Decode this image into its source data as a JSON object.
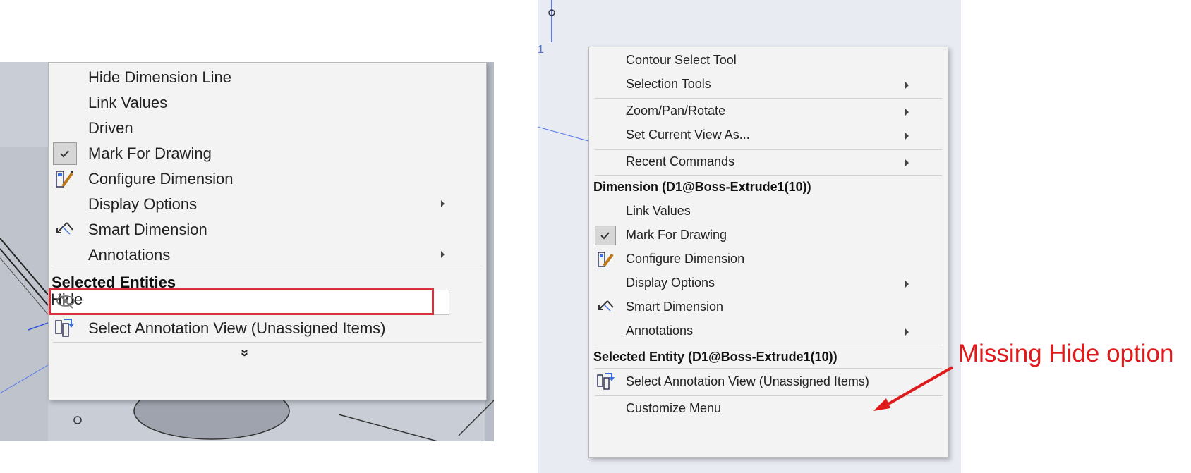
{
  "left_menu": {
    "items": [
      {
        "label": "Hide Dimension Line"
      },
      {
        "label": "Link Values"
      },
      {
        "label": "Driven"
      },
      {
        "label": "Mark For Drawing",
        "icon": "checkmark-icon",
        "checked": true
      },
      {
        "label": "Configure Dimension",
        "icon": "configure-dimension-icon"
      },
      {
        "label": "Display Options",
        "submenu": true
      },
      {
        "label": "Smart Dimension",
        "icon": "smart-dimension-icon"
      },
      {
        "label": "Annotations",
        "submenu": true
      }
    ],
    "section_header": "Selected Entities",
    "hide_item": {
      "label": "Hide",
      "icon": "eye-slash-icon",
      "highlight_color": "#d6303a"
    },
    "annotation_view_item": {
      "label": "Select Annotation View (Unassigned Items)",
      "icon": "annotation-view-icon"
    },
    "expand_glyph": "»"
  },
  "right_menu": {
    "items_top": [
      {
        "label": "Contour Select Tool"
      },
      {
        "label": "Selection Tools",
        "submenu": true
      },
      {
        "label": "Zoom/Pan/Rotate",
        "submenu": true
      },
      {
        "label": "Set Current View As...",
        "submenu": true
      },
      {
        "label": "Recent Commands",
        "submenu": true
      }
    ],
    "dimension_header": "Dimension (D1@Boss-Extrude1(10))",
    "items_dimension": [
      {
        "label": "Link Values"
      },
      {
        "label": "Mark For Drawing",
        "icon": "checkmark-icon",
        "checked": true
      },
      {
        "label": "Configure Dimension",
        "icon": "configure-dimension-icon"
      },
      {
        "label": "Display Options",
        "submenu": true
      },
      {
        "label": "Smart Dimension",
        "icon": "smart-dimension-icon"
      },
      {
        "label": "Annotations",
        "submenu": true
      }
    ],
    "entity_header": "Selected Entity (D1@Boss-Extrude1(10))",
    "annotation_view_item": {
      "label": "Select Annotation View (Unassigned Items)",
      "icon": "annotation-view-icon"
    },
    "customize_item": {
      "label": "Customize Menu"
    }
  },
  "annotation": {
    "text": "Missing Hide option",
    "color": "#e01a1a"
  },
  "colors": {
    "menu_bg": "#f3f3f3",
    "cad_bg_left": "#c9cdd6",
    "cad_bg_right": "#e8ebf2"
  }
}
